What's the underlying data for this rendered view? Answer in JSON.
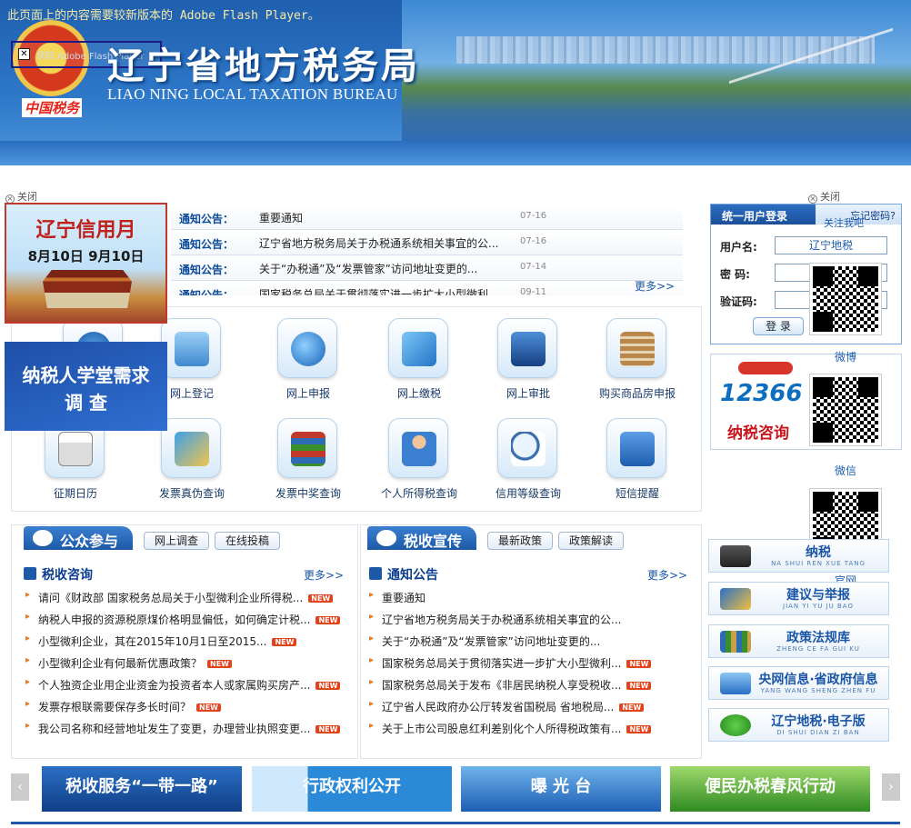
{
  "header": {
    "flash_notice": "此页面上的内容需要较新版本的 Adobe Flash Player。",
    "flash_get_label": "获取 Adobe Flash Player",
    "title": "辽宁省地方税务局",
    "subtitle": "LIAO NING LOCAL TAXATION BUREAU",
    "emblem_text": "中国税务"
  },
  "close_label": "关闭",
  "left_ads": {
    "credit_title": "辽宁信用月",
    "credit_dates": "8月10日 9月10日",
    "survey_line1": "纳税人学堂需求",
    "survey_line2": "调 查"
  },
  "notices": {
    "more": "更多>>",
    "items": [
      {
        "label": "通知公告：",
        "text": "重要通知",
        "date": "07-16"
      },
      {
        "label": "通知公告：",
        "text": "辽宁省地方税务局关于办税通系统相关事宜的公...",
        "date": "07-16"
      },
      {
        "label": "通知公告：",
        "text": "关于“办税通”及“发票管家”访问地址变更的...",
        "date": "07-14"
      },
      {
        "label": "通知公告：",
        "text": "国家税务总局关于贯彻落实进一步扩大小型微利...",
        "date": "09-11"
      }
    ]
  },
  "services": [
    {
      "label": "纳税人学堂需求调查",
      "icon": "compass-icon"
    },
    {
      "label": "网上登记",
      "icon": "monitor-icon"
    },
    {
      "label": "网上申报",
      "icon": "globe-icon"
    },
    {
      "label": "网上缴税",
      "icon": "folder-icon"
    },
    {
      "label": "网上审批",
      "icon": "screen-icon"
    },
    {
      "label": "购买商品房申报",
      "icon": "building-icon"
    },
    {
      "label": "征期日历",
      "icon": "calendar-icon"
    },
    {
      "label": "发票真伪查询",
      "icon": "files-icon"
    },
    {
      "label": "发票中奖查询",
      "icon": "books-icon"
    },
    {
      "label": "个人所得税查询",
      "icon": "person-icon"
    },
    {
      "label": "信用等级查询",
      "icon": "magnifier-icon"
    },
    {
      "label": "短信提醒",
      "icon": "envelope-icon"
    }
  ],
  "login": {
    "tab": "统一用户登录",
    "forgot": "忘记密码?",
    "follow": "关注我吧",
    "username_label": "用户名:",
    "username_value": "辽宁地税",
    "password_label": "密  码:",
    "captcha_label": "验证码:",
    "button": "登 录"
  },
  "qr_codes": {
    "weibo": "微博",
    "weixin": "微信",
    "official": "官网"
  },
  "hotline": {
    "number": "12366",
    "label": "纳税咨询"
  },
  "public": {
    "title": "公众参与",
    "tab1": "网上调查",
    "tab2": "在线投稿",
    "column_title": "税收咨询",
    "more": "更多>>",
    "items": [
      {
        "text": "请问《财政部 国家税务总局关于小型微利企业所得税...",
        "new": "NEW"
      },
      {
        "text": "纳税人申报的资源税原煤价格明显偏低，如何确定计税...",
        "new": "NEW"
      },
      {
        "text": "小型微利企业，其在2015年10月1日至2015...",
        "new": "NEW"
      },
      {
        "text": "小型微利企业有何最新优惠政策？",
        "new": "NEW"
      },
      {
        "text": "个人独资企业用企业资金为投资者本人或家属购买房产...",
        "new": "NEW"
      },
      {
        "text": "发票存根联需要保存多长时间？",
        "new": "NEW"
      },
      {
        "text": "我公司名称和经营地址发生了变更，办理营业执照变更...",
        "new": "NEW"
      }
    ]
  },
  "publicity": {
    "title": "税收宣传",
    "tab1": "最新政策",
    "tab2": "政策解读",
    "column_title": "通知公告",
    "more": "更多>>",
    "items": [
      {
        "text": "重要通知",
        "new": ""
      },
      {
        "text": "辽宁省地方税务局关于办税通系统相关事宜的公...",
        "new": ""
      },
      {
        "text": "关于“办税通”及“发票管家”访问地址变更的...",
        "new": ""
      },
      {
        "text": "国家税务总局关于贯彻落实进一步扩大小型微利...",
        "new": "NEW"
      },
      {
        "text": "国家税务总局关于发布《非居民纳税人享受税收...",
        "new": "NEW"
      },
      {
        "text": "辽宁省人民政府办公厅转发省国税局 省地税局...",
        "new": "NEW"
      },
      {
        "text": "关于上市公司股息红利差别化个人所得税政策有...",
        "new": "NEW"
      }
    ]
  },
  "side_links": [
    {
      "title": "纳税",
      "pinyin": "NA SHUI REN XUE TANG"
    },
    {
      "title": "建议与举报",
      "pinyin": "JIAN YI YU JU BAO"
    },
    {
      "title": "政策法规库",
      "pinyin": "ZHENG CE FA GUI KU"
    },
    {
      "title": "央网信息·省政府信息",
      "pinyin": "YANG WANG SHENG ZHEN FU"
    },
    {
      "title": "辽宁地税·电子版",
      "pinyin": "DI SHUI DIAN ZI BAN"
    }
  ],
  "banners": [
    {
      "text": "税收服务“一带一路”",
      "color": "#1e5fb0"
    },
    {
      "text": "行政权利公开",
      "color": "#2a8ad8"
    },
    {
      "text": "曝 光 台",
      "color": "#2f6fc4"
    },
    {
      "text": "便民办税春风行动",
      "color": "#3a8f2a"
    }
  ],
  "carousel": {
    "prev": "‹",
    "next": "›"
  }
}
